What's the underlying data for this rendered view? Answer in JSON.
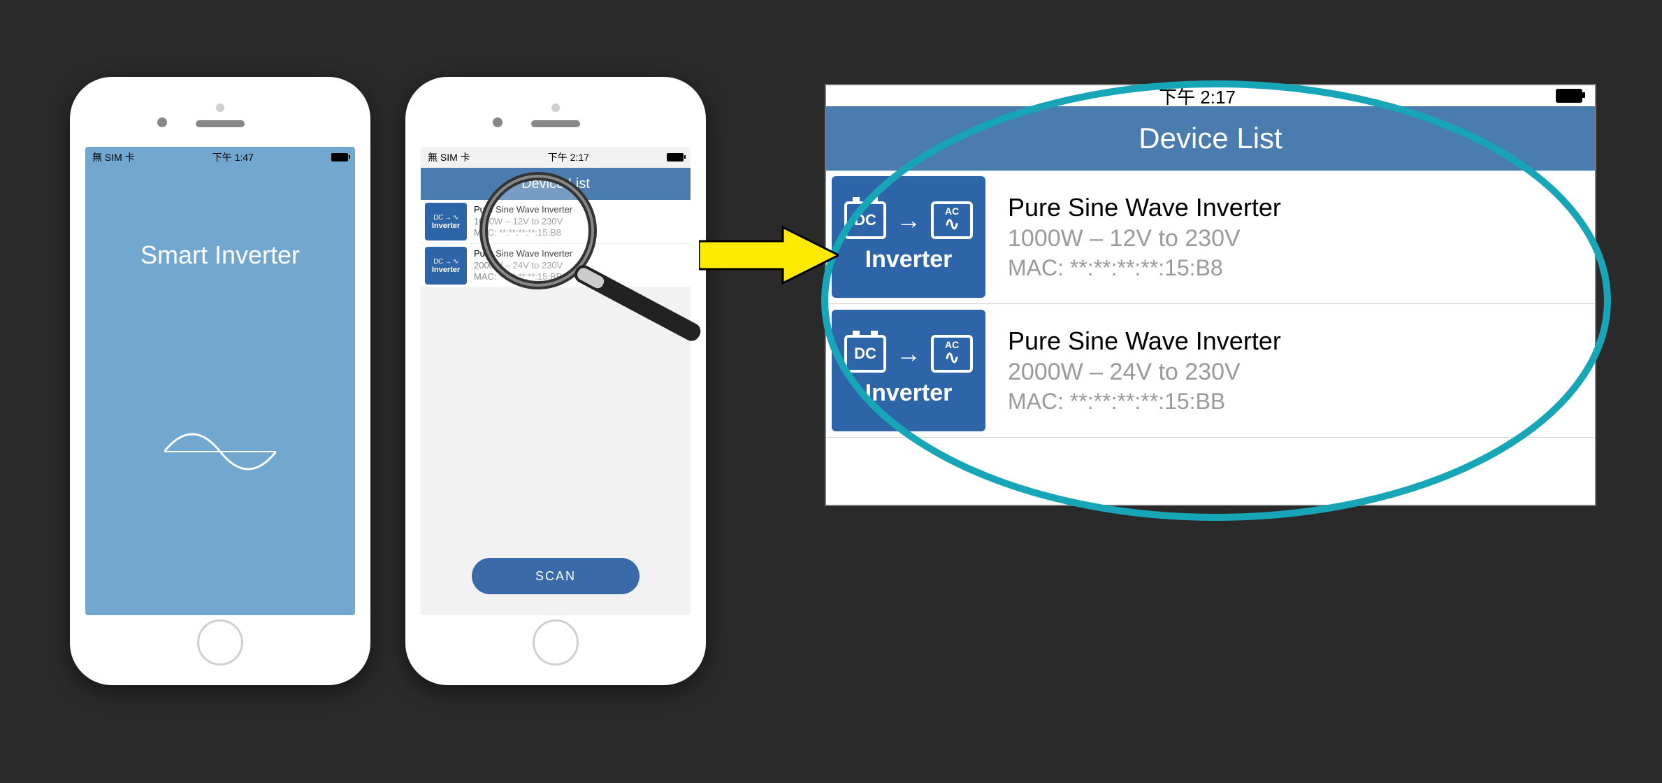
{
  "phone1": {
    "status_left": "無 SIM 卡",
    "status_time": "下午 1:47",
    "splash_title": "Smart Inverter"
  },
  "phone2": {
    "status_left": "無 SIM 卡",
    "status_time": "下午 2:17",
    "header": "Device List",
    "scan": "SCAN",
    "items": [
      {
        "title": "Pure Sine Wave Inverter",
        "spec": "1000W – 12V to 230V",
        "mac": "MAC: **:**:**:**:15:B8",
        "icon_label": "Inverter"
      },
      {
        "title": "Pure Sine Wave Inverter",
        "spec": "2000W – 24V to 230V",
        "mac": "MAC: **:**:**:**:15:BB",
        "icon_label": "Inverter"
      }
    ]
  },
  "zoom": {
    "status_time": "下午 2:17",
    "header": "Device List",
    "items": [
      {
        "title": "Pure Sine Wave Inverter",
        "spec": "1000W – 12V to 230V",
        "mac": "MAC: **:**:**:**:15:B8",
        "dc": "DC",
        "ac": "AC",
        "label": "Inverter"
      },
      {
        "title": "Pure Sine Wave Inverter",
        "spec": "2000W – 24V to 230V",
        "mac": "MAC: **:**:**:**:15:BB",
        "dc": "DC",
        "ac": "AC",
        "label": "Inverter"
      }
    ]
  }
}
